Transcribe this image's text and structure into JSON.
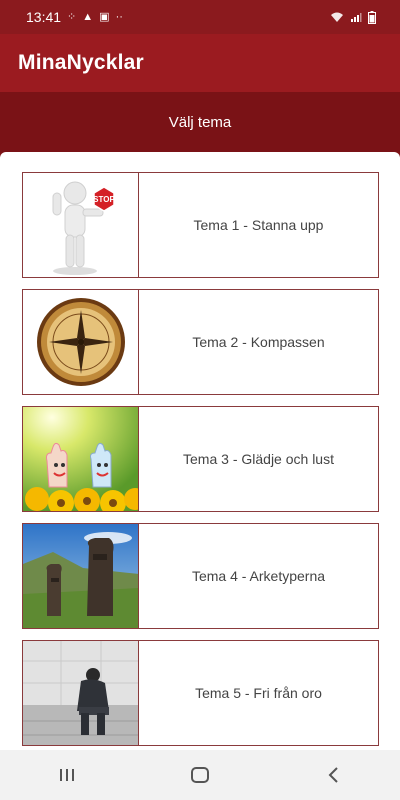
{
  "status_bar": {
    "time": "13:41",
    "left_icons": [
      "notification-dots-icon",
      "warning-icon",
      "screenshot-icon",
      "more-dots-icon"
    ],
    "right_icons": [
      "wifi-icon",
      "signal-icon",
      "battery-icon"
    ]
  },
  "app_bar": {
    "title": "MinaNycklar"
  },
  "subheader": {
    "title": "Välj tema"
  },
  "themes": [
    {
      "label": "Tema 1 - Stanna upp",
      "image": "stop-sign-figure",
      "badge": "STOP"
    },
    {
      "label": "Tema 2 - Kompassen",
      "image": "compass"
    },
    {
      "label": "Tema 3 - Glädje och lust",
      "image": "happy-hands-sunflowers"
    },
    {
      "label": "Tema 4 - Arketyperna",
      "image": "moai-statues"
    },
    {
      "label": "Tema 5 - Fri från oro",
      "image": "worried-man"
    }
  ],
  "nav_bar": {
    "items": [
      "recent-apps-icon",
      "home-icon",
      "back-icon"
    ]
  },
  "colors": {
    "primary": "#9b1b20",
    "primary_dark": "#7a1216",
    "card_border": "#8a3a3c"
  }
}
